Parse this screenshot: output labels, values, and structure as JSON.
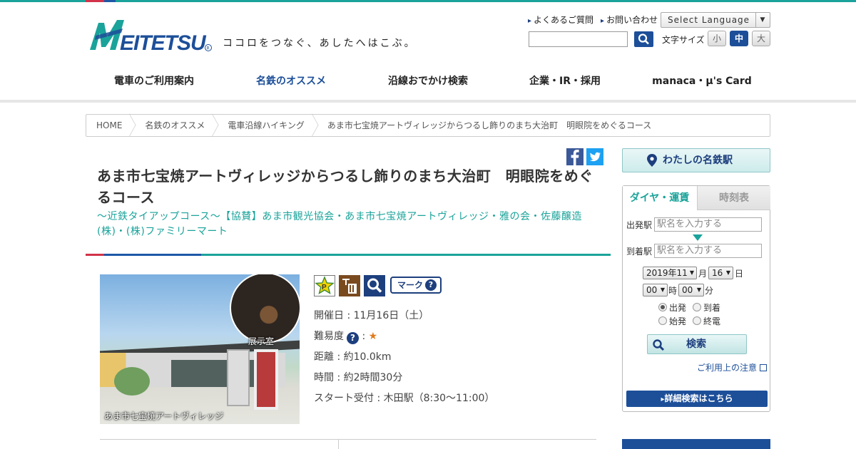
{
  "brand": {
    "logo_text": "MEITETSU",
    "slogan": "ココロをつなぐ、あしたへはこぶ。",
    "colors": {
      "teal": "#1aa39a",
      "navy": "#1d4f99",
      "red": "#d2334a"
    }
  },
  "header": {
    "faq": "よくあるご質問",
    "contact": "お問い合わせ",
    "language": "Select Language",
    "fontsize_label": "文字サイズ",
    "fontsize_small": "小",
    "fontsize_medium": "中",
    "fontsize_large": "大"
  },
  "nav": [
    {
      "label": "電車のご利用案内"
    },
    {
      "label": "名鉄のオススメ",
      "active": true
    },
    {
      "label": "沿線おでかけ検索"
    },
    {
      "label": "企業・IR・採用"
    },
    {
      "label": "manaca・μ's Card"
    }
  ],
  "breadcrumb": [
    "HOME",
    "名鉄のオススメ",
    "電車沿線ハイキング",
    "あま市七宝焼アートヴィレッジからつるし飾りのまち大治町　明眼院をめぐるコース"
  ],
  "article": {
    "title": "あま市七宝焼アートヴィレッジからつるし飾りのまち大治町　明眼院をめぐるコース",
    "subtitle": "～近鉄タイアップコース～【協賛】あま市観光協会・あま市七宝焼アートヴィレッジ・雅の会・佐藤醸造(株)・(株)ファミリーマート",
    "photo_caption_room": "展示室",
    "photo_caption_main": "あま市七宝焼アートヴィレッジ",
    "mark_label": "マーク",
    "date": "開催日 : 11月16日（土）",
    "difficulty_label": "難易度",
    "difficulty_sep": ":",
    "difficulty_stars": "★",
    "distance": "距離 : 約10.0km",
    "time": "時間 : 約2時間30分",
    "start": "スタート受付 : 木田駅（8:30～11:00）"
  },
  "sidebar": {
    "my_station": "わたしの名鉄駅",
    "tab_active": "ダイヤ・運賃",
    "tab_inactive": "時刻表",
    "from_label": "出発駅",
    "to_label": "到着駅",
    "station_placeholder": "駅名を入力する",
    "year_month": "2019年11",
    "month_unit": "月",
    "day": "16",
    "day_unit": "日",
    "hour": "00",
    "hour_unit": "時",
    "minute": "00",
    "minute_unit": "分",
    "radio_depart": "出発",
    "radio_arrive": "到着",
    "radio_first": "始発",
    "radio_last": "終電",
    "search_button": "検索",
    "notes_link": "ご利用上の注意",
    "detail_button": "詳細検索はこちら"
  }
}
